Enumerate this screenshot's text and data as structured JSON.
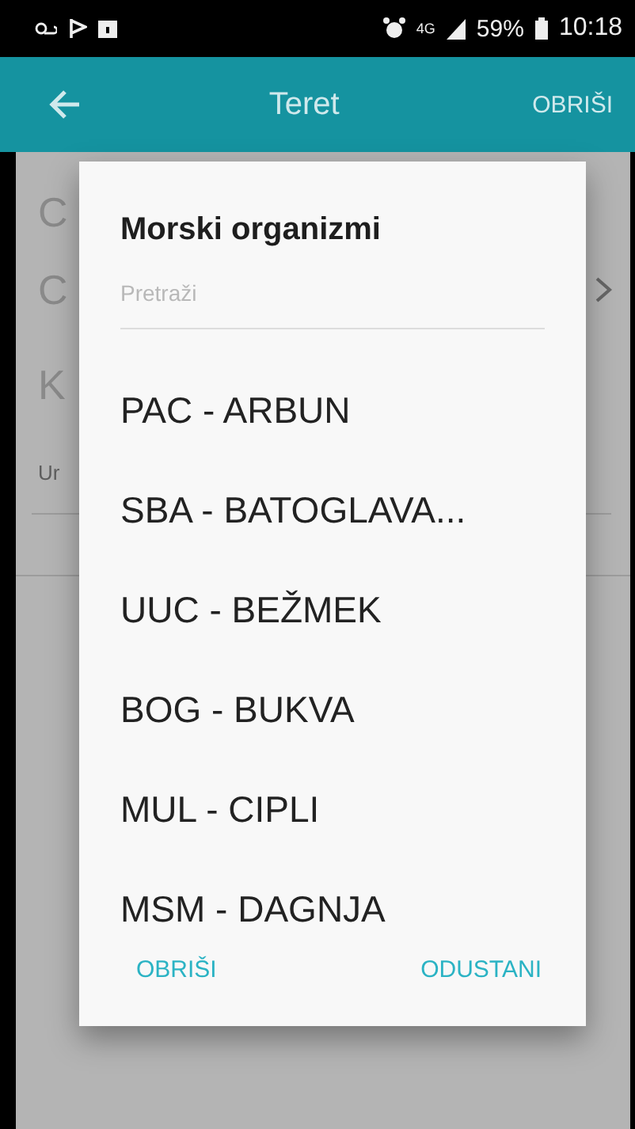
{
  "status_bar": {
    "network": "4G",
    "battery": "59%",
    "time": "10:18"
  },
  "toolbar": {
    "title": "Teret",
    "action": "OBRIŠI"
  },
  "background_form": {
    "rows": [
      {
        "kind": "field",
        "text": "C"
      },
      {
        "kind": "chevron",
        "text": "C"
      },
      {
        "kind": "field",
        "text": "K"
      },
      {
        "kind": "hint",
        "text": "Ur"
      }
    ]
  },
  "dialog": {
    "title": "Morski organizmi",
    "search": {
      "placeholder": "Pretraži"
    },
    "items": [
      "PAC - ARBUN",
      "SBA - BATOGLAVA...",
      "UUC - BEŽMEK",
      "BOG - BUKVA",
      "MUL - CIPLI",
      "MSM - DAGNJA"
    ],
    "buttons": [
      "OBRIŠI",
      "ODUSTANI"
    ]
  }
}
